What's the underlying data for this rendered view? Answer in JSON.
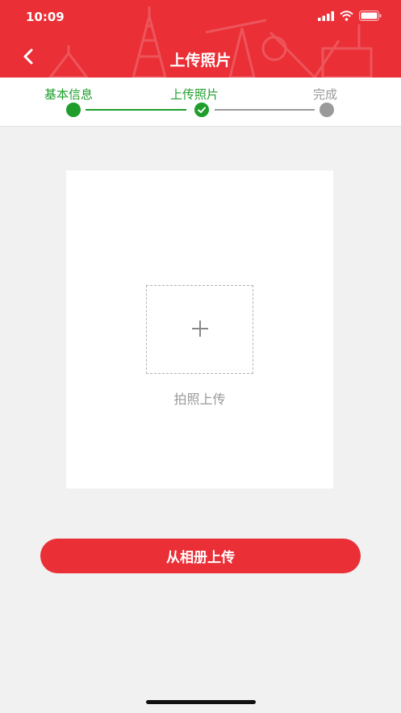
{
  "status_bar": {
    "time": "10:09",
    "signal_icon": "signal-bars-icon",
    "wifi_icon": "wifi-icon",
    "battery_icon": "battery-icon"
  },
  "nav": {
    "title": "上传照片",
    "back_icon": "chevron-left-icon"
  },
  "steps": [
    {
      "label": "基本信息",
      "state": "done"
    },
    {
      "label": "上传照片",
      "state": "current"
    },
    {
      "label": "完成",
      "state": "pending"
    }
  ],
  "upload": {
    "icon": "plus-icon",
    "label": "拍照上传"
  },
  "album_button": {
    "label": "从相册上传"
  },
  "colors": {
    "brand_red": "#ea2f37",
    "step_green": "#1f9e2c",
    "step_gray": "#9a9a9a",
    "background": "#f1f1f1"
  }
}
